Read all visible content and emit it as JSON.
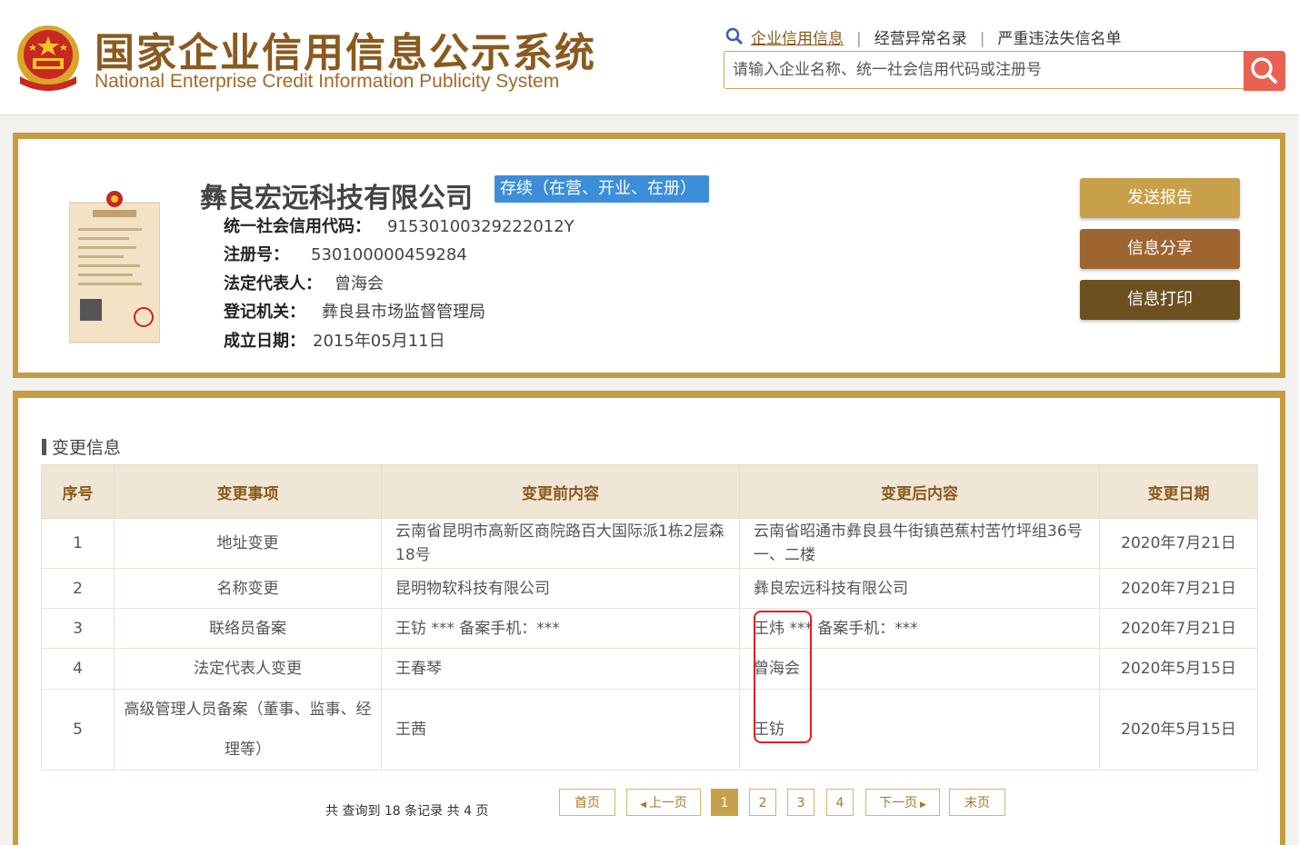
{
  "header": {
    "title": "国家企业信用信息公示系统",
    "subtitle": "National Enterprise Credit Information Publicity System",
    "nav": [
      "企业信用信息",
      "经营异常名录",
      "严重违法失信名单"
    ],
    "search_placeholder": "请输入企业名称、统一社会信用代码或注册号"
  },
  "company": {
    "name": "彝良宏远科技有限公司",
    "status": "存续（在营、开业、在册）",
    "fields": [
      {
        "label": "统一社会信用代码：",
        "value": "91530100329222012Y"
      },
      {
        "label": "注册号：",
        "value": "530100000459284"
      },
      {
        "label": "法定代表人：",
        "value": "曾海会"
      },
      {
        "label": "登记机关：",
        "value": "彝良县市场监督管理局"
      },
      {
        "label": "成立日期：",
        "value": "2015年05月11日"
      }
    ]
  },
  "actions": {
    "send": "发送报告",
    "share": "信息分享",
    "print": "信息打印"
  },
  "section": {
    "title": "变更信息"
  },
  "table": {
    "headers": [
      "序号",
      "变更事项",
      "变更前内容",
      "变更后内容",
      "变更日期"
    ],
    "rows": [
      [
        "1",
        "地址变更",
        "云南省昆明市高新区商院路百大国际派1栋2层森18号",
        "云南省昭通市彝良县牛街镇芭蕉村苦竹坪组36号一、二楼",
        "2020年7月21日"
      ],
      [
        "2",
        "名称变更",
        "昆明物软科技有限公司",
        "彝良宏远科技有限公司",
        "2020年7月21日"
      ],
      [
        "3",
        "联络员备案",
        "王钫 *** 备案手机：***",
        "王炜 *** 备案手机：***",
        "2020年7月21日"
      ],
      [
        "4",
        "法定代表人变更",
        "王春琴",
        "曾海会",
        "2020年5月15日"
      ],
      [
        "5",
        "高级管理人员备案（董事、监事、经理等）",
        "王茜",
        "王钫",
        "2020年5月15日"
      ]
    ]
  },
  "pager": {
    "total": "共 查询到 18 条记录 共 4 页",
    "first": "首页",
    "prev": "上一页",
    "pages": [
      "1",
      "2",
      "3",
      "4"
    ],
    "next": "下一页",
    "last": "末页",
    "current": "1"
  },
  "colors": {
    "gold": "#c59c41",
    "brown": "#8a5a1e",
    "status_blue": "#3c8ed9",
    "search_red": "#e86151",
    "highlight_red": "#e21f1f"
  }
}
